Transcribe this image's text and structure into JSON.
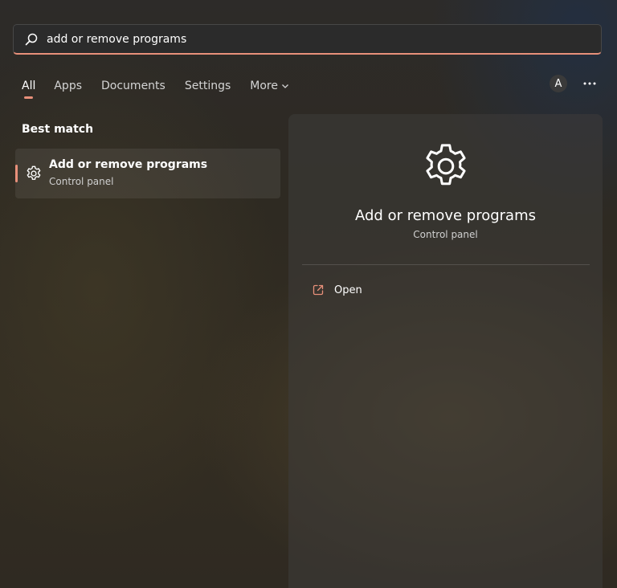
{
  "search": {
    "value": "add or remove programs",
    "icon": "search-icon"
  },
  "tabs": [
    {
      "label": "All",
      "active": true
    },
    {
      "label": "Apps"
    },
    {
      "label": "Documents"
    },
    {
      "label": "Settings"
    },
    {
      "label": "More"
    }
  ],
  "account": {
    "initial": "A"
  },
  "best_match": {
    "heading": "Best match",
    "title": "Add or remove programs",
    "subtitle": "Control panel",
    "icon": "gear-icon"
  },
  "detail": {
    "title": "Add or remove programs",
    "subtitle": "Control panel",
    "icon": "gear-icon",
    "actions": [
      {
        "label": "Open",
        "icon": "open-external-icon"
      }
    ]
  },
  "colors": {
    "accent": "#e8907a",
    "text": "#ffffff",
    "muted": "#cfcfcf"
  }
}
